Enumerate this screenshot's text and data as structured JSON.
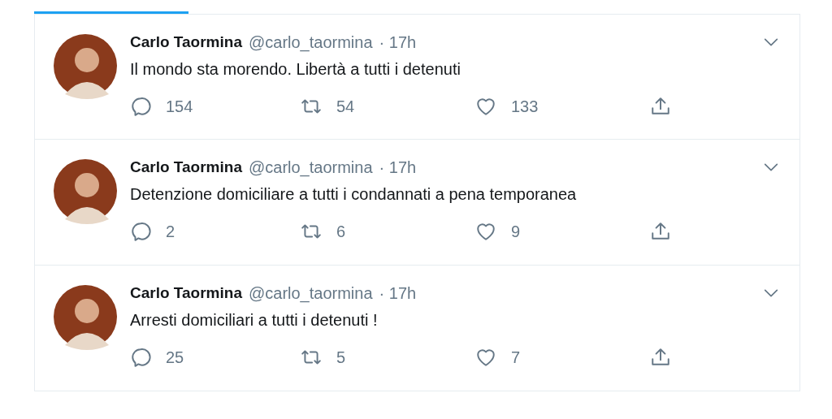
{
  "tweets": [
    {
      "name": "Carlo Taormina",
      "handle": "@carlo_taormina",
      "time": "· 17h",
      "text": "Il mondo sta morendo. Libertà a tutti i detenuti",
      "replies": "154",
      "retweets": "54",
      "likes": "133"
    },
    {
      "name": "Carlo Taormina",
      "handle": "@carlo_taormina",
      "time": "· 17h",
      "text": "Detenzione domiciliare a tutti i condannati a pena temporanea",
      "replies": "2",
      "retweets": "6",
      "likes": "9"
    },
    {
      "name": "Carlo Taormina",
      "handle": "@carlo_taormina",
      "time": "· 17h",
      "text": "Arresti domiciliari a tutti i detenuti !",
      "replies": "25",
      "retweets": "5",
      "likes": "7"
    }
  ]
}
